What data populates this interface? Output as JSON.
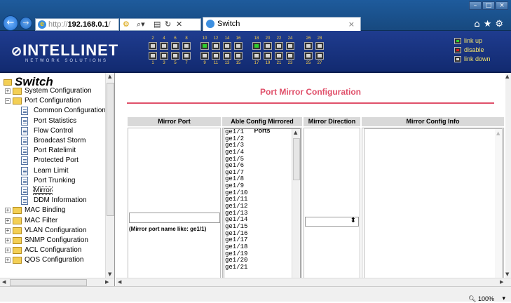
{
  "browser": {
    "url_proto": "http://",
    "url_host": "192.168.0.1",
    "url_rest": "/",
    "tab_title": "Switch",
    "zoom": "100%"
  },
  "device": {
    "brand": "INTELLINET",
    "brand_sub": "NETWORK SOLUTIONS",
    "ports_top_labels": [
      "2",
      "4",
      "6",
      "8",
      "10",
      "12",
      "14",
      "16",
      "18",
      "20",
      "22",
      "24",
      "26",
      "28"
    ],
    "ports_bottom_labels": [
      "1",
      "3",
      "5",
      "7",
      "9",
      "11",
      "13",
      "15",
      "17",
      "19",
      "21",
      "23",
      "25",
      "27"
    ],
    "ports_link_up": [
      "10",
      "18"
    ],
    "legend": [
      "link up",
      "disable",
      "link down"
    ]
  },
  "tree": {
    "root": "Switch",
    "items": [
      {
        "label": "System Configuration",
        "type": "folder"
      },
      {
        "label": "Port Configuration",
        "type": "folder-open"
      },
      {
        "label": "Common Configuration",
        "type": "page"
      },
      {
        "label": "Port Statistics",
        "type": "page"
      },
      {
        "label": "Flow Control",
        "type": "page"
      },
      {
        "label": "Broadcast Storm",
        "type": "page"
      },
      {
        "label": "Port Ratelimit",
        "type": "page"
      },
      {
        "label": "Protected Port",
        "type": "page"
      },
      {
        "label": "Learn Limit",
        "type": "page"
      },
      {
        "label": "Port Trunking",
        "type": "page"
      },
      {
        "label": "Mirror",
        "type": "page"
      },
      {
        "label": "DDM Information",
        "type": "page"
      },
      {
        "label": "MAC Binding",
        "type": "folder"
      },
      {
        "label": "MAC Filter",
        "type": "folder"
      },
      {
        "label": "VLAN Configuration",
        "type": "folder"
      },
      {
        "label": "SNMP Configuration",
        "type": "folder"
      },
      {
        "label": "ACL Configuration",
        "type": "folder"
      },
      {
        "label": "QOS Configuration",
        "type": "folder"
      }
    ]
  },
  "main": {
    "title": "Port Mirror Configuration",
    "headers": [
      "Mirror Port",
      "Able Config Mirrored Ports",
      "Mirror Direction",
      "Mirror Config Info"
    ],
    "mirror_port_value": "",
    "mirror_port_hint": "(Mirror port name like: ge1/1)",
    "ports": [
      "ge1/1",
      "ge1/2",
      "ge1/3",
      "ge1/4",
      "ge1/5",
      "ge1/6",
      "ge1/7",
      "ge1/8",
      "ge1/9",
      "ge1/10",
      "ge1/11",
      "ge1/12",
      "ge1/13",
      "ge1/14",
      "ge1/15",
      "ge1/16",
      "ge1/17",
      "ge1/18",
      "ge1/19",
      "ge1/20",
      "ge1/21"
    ],
    "direction_value": ""
  }
}
